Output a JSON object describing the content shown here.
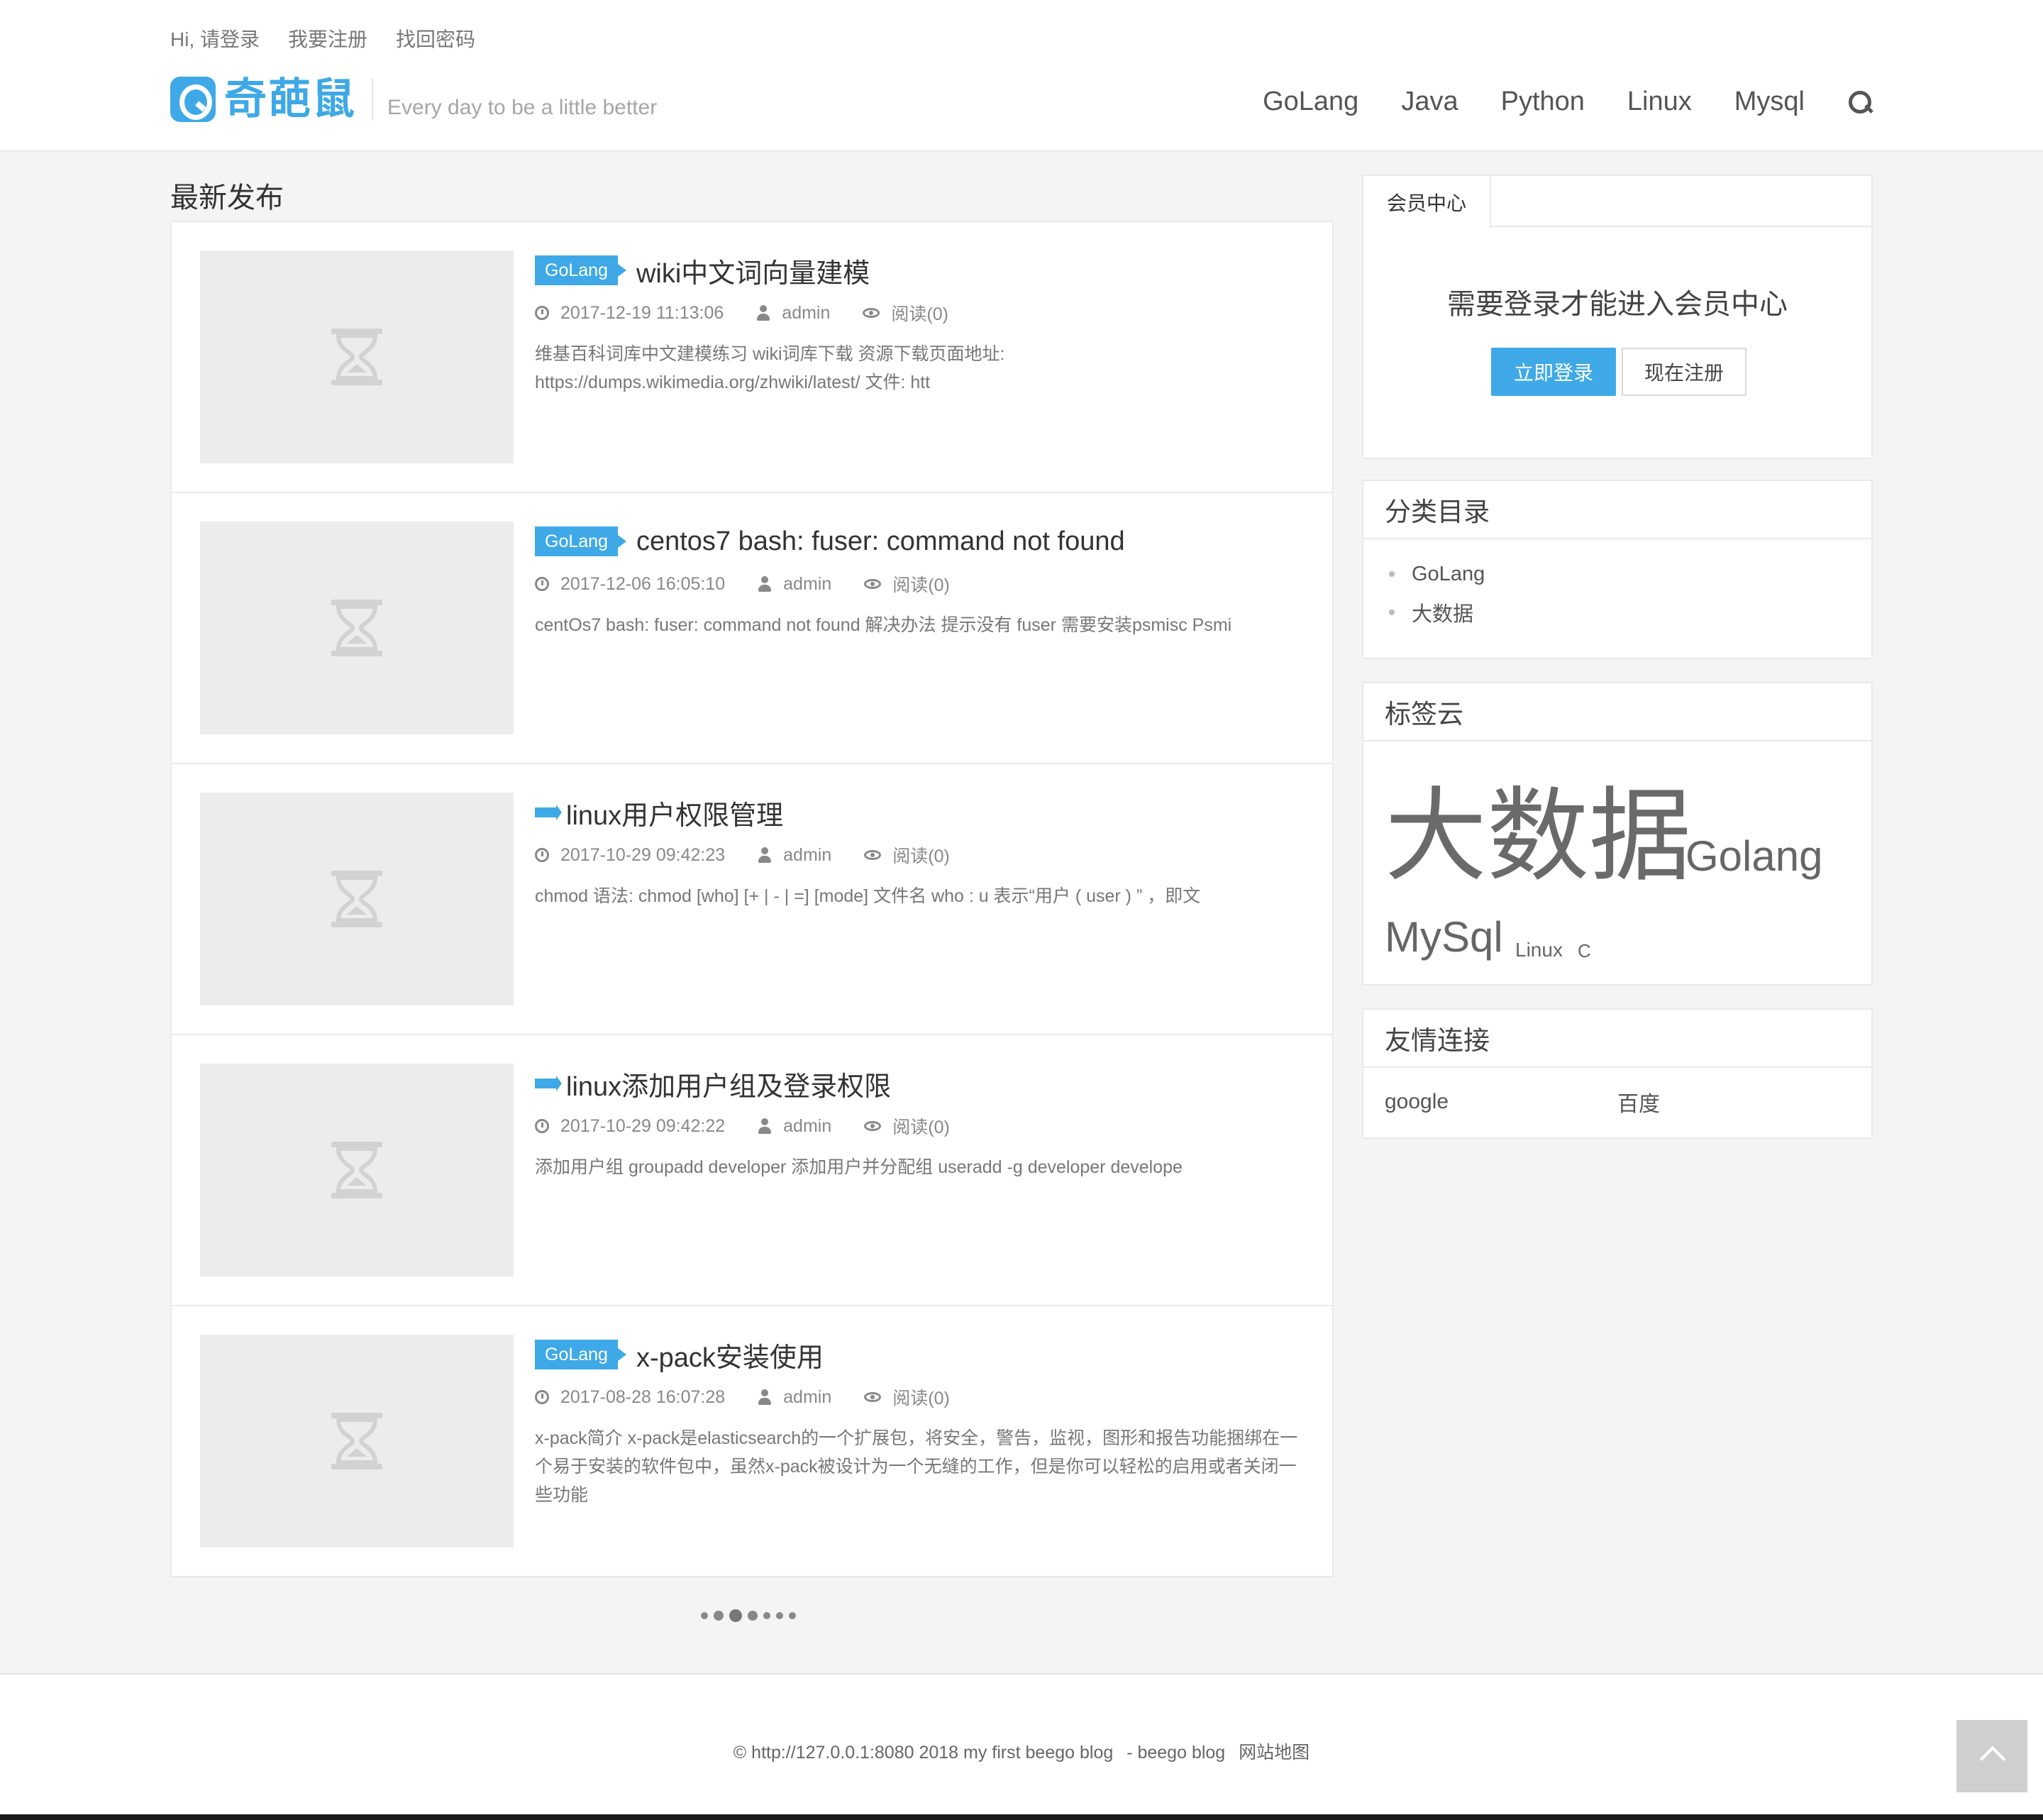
{
  "header": {
    "top_links": [
      "Hi, 请登录",
      "我要注册",
      "找回密码"
    ],
    "logo_text": "奇葩鼠",
    "slogan": "Every day to be a little better",
    "nav": [
      "GoLang",
      "Java",
      "Python",
      "Linux",
      "Mysql"
    ],
    "icons": {
      "search": "search-icon"
    }
  },
  "main": {
    "section_title": "最新发布",
    "posts": [
      {
        "category": "GoLang",
        "title": "wiki中文词向量建模",
        "datetime": "2017-12-19 11:13:06",
        "author": "admin",
        "views": "阅读(0)",
        "excerpt": "维基百科词库中文建模练习 wiki词库下载 资源下载页面地址: https://dumps.wikimedia.org/zhwiki/latest/ 文件: htt"
      },
      {
        "category": "GoLang",
        "title": "centos7 bash: fuser: command not found",
        "datetime": "2017-12-06 16:05:10",
        "author": "admin",
        "views": "阅读(0)",
        "excerpt": "centOs7 bash: fuser: command not found 解决办法 提示没有 fuser 需要安装psmisc Psmi"
      },
      {
        "category": "",
        "title": "linux用户权限管理",
        "datetime": "2017-10-29 09:42:23",
        "author": "admin",
        "views": "阅读(0)",
        "excerpt": "chmod 语法: chmod [who] [+ | - | =] [mode] 文件名 who : u 表示“用户 ( user ) ” ，即文"
      },
      {
        "category": "",
        "title": "linux添加用户组及登录权限",
        "datetime": "2017-10-29 09:42:22",
        "author": "admin",
        "views": "阅读(0)",
        "excerpt": "添加用户组 groupadd developer 添加用户并分配组 useradd -g developer develope"
      },
      {
        "category": "GoLang",
        "title": "x-pack安装使用",
        "datetime": "2017-08-28 16:07:28",
        "author": "admin",
        "views": "阅读(0)",
        "excerpt": "x-pack简介 x-pack是elasticsearch的一个扩展包，将安全，警告，监视，图形和报告功能捆绑在一个易于安装的软件包中，虽然x-pack被设计为一个无缝的工作，但是你可以轻松的启用或者关闭一些功能"
      }
    ],
    "pager_dots": 7,
    "pager_active": 3
  },
  "sidebar": {
    "member": {
      "tab": "会员中心",
      "message": "需要登录才能进入会员中心",
      "login_button": "立即登录",
      "register_button": "现在注册"
    },
    "categories": {
      "title": "分类目录",
      "items": [
        "GoLang",
        "大数据"
      ]
    },
    "tags": {
      "title": "标签云",
      "items": [
        "大数据",
        "Golang",
        "MySql",
        "Linux",
        "C"
      ]
    },
    "links": {
      "title": "友情连接",
      "items": [
        "google",
        "百度"
      ]
    }
  },
  "footer": {
    "copyright": "© http://127.0.0.1:8080 2018 my first beego blog",
    "powered": "- beego blog",
    "sitemap": "网站地图"
  },
  "colors": {
    "accent": "#3ea9e6",
    "background": "#f4f4f4"
  }
}
